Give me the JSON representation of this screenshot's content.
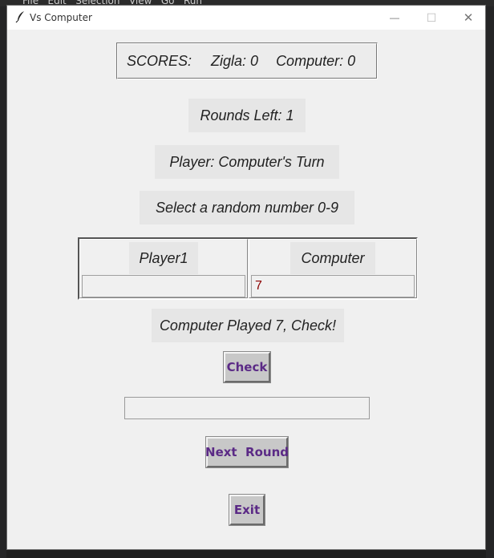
{
  "background": {
    "menu_text": "File   Edit   Selection   View   Go   Run"
  },
  "window": {
    "title": "Vs Computer",
    "controls": {
      "minimize": "—",
      "maximize": "☐",
      "close": "✕"
    }
  },
  "scores": {
    "label": "SCORES:",
    "player": "Zigla: 0",
    "computer": "Computer: 0"
  },
  "rounds_left": "Rounds Left: 1",
  "player_turn": "Player: Computer's Turn",
  "instruction": "Select a random number 0-9",
  "board": {
    "columns": [
      {
        "header": "Player1",
        "value": ""
      },
      {
        "header": "Computer",
        "value": "7"
      }
    ]
  },
  "status_message": "Computer Played 7, Check!",
  "buttons": {
    "check": "Check",
    "next_round": "Next  Round",
    "exit": "Exit"
  },
  "guess_input": {
    "value": ""
  },
  "colors": {
    "button_text": "#5b2a86",
    "entry_text": "#8b0000",
    "window_bg": "#f0f0f0"
  }
}
